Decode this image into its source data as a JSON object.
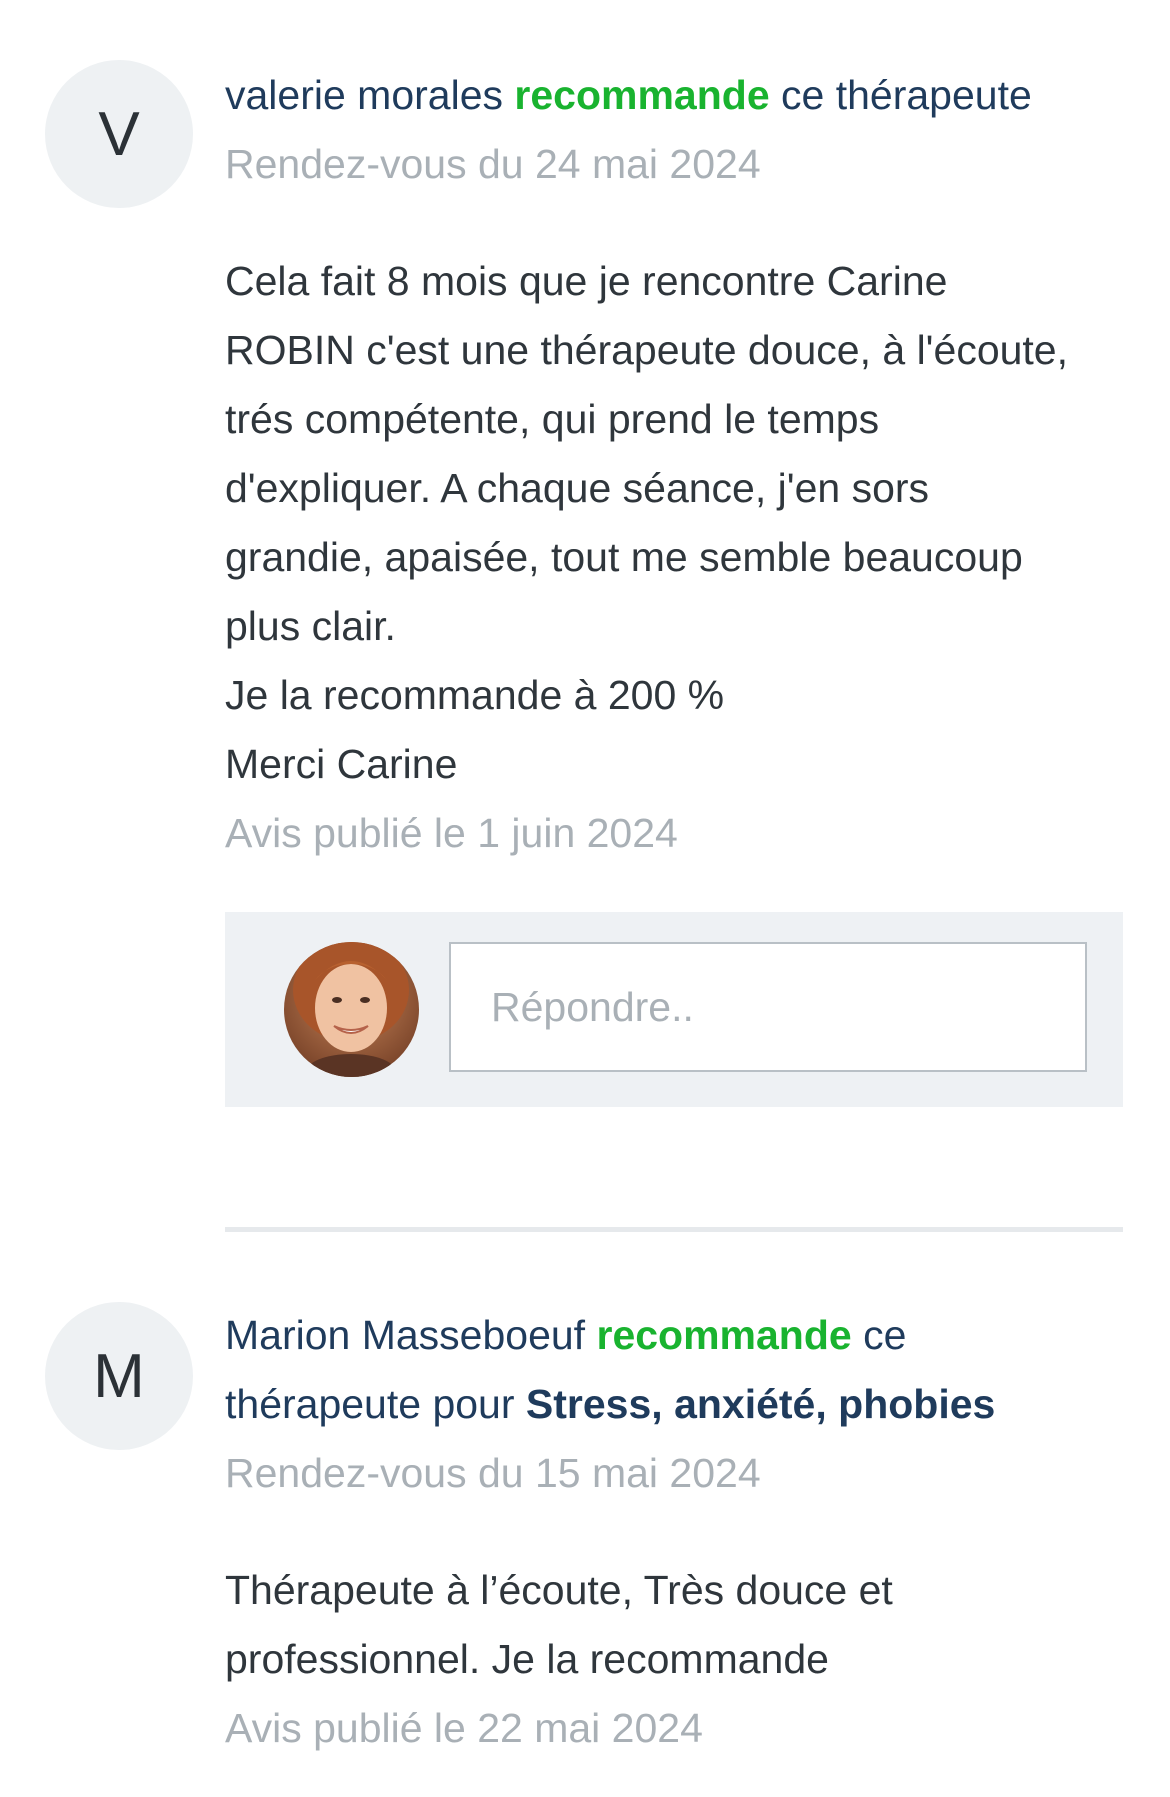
{
  "reviews": [
    {
      "initial": "V",
      "author": "valerie morales",
      "recommend_word": "recommande",
      "verb_rest": "ce thérapeute",
      "appointment": "Rendez-vous du 24 mai 2024",
      "body_lines": [
        "Cela fait 8 mois que je rencontre Carine",
        "ROBIN c'est une thérapeute douce, à l'écoute,",
        "trés compétente,  qui prend le temps",
        "d'expliquer.  A chaque séance, j'en sors",
        "grandie, apaisée,  tout me semble beaucoup",
        "plus clair.",
        "Je la recommande à 200 %",
        "Merci Carine"
      ],
      "published": "Avis publié le 1 juin 2024",
      "reply_placeholder": "Répondre.."
    },
    {
      "initial": "M",
      "author": "Marion Masseboeuf",
      "recommend_word": "recommande",
      "verb_rest_1": "ce",
      "verb_rest_2": "thérapeute pour",
      "topic": "Stress, anxiété, phobies",
      "appointment": "Rendez-vous du 15 mai 2024",
      "body_lines": [
        "Thérapeute à l’écoute, Très douce et",
        "professionnel. Je la recommande"
      ],
      "published": "Avis publié le 22 mai 2024"
    }
  ],
  "colors": {
    "recommend_green": "#19b32f",
    "author_navy": "#1f3b5c",
    "muted_gray": "#a9b0b6",
    "reply_panel": "#eef1f4"
  },
  "icons": {
    "therapist_avatar": "therapist-photo-icon"
  }
}
